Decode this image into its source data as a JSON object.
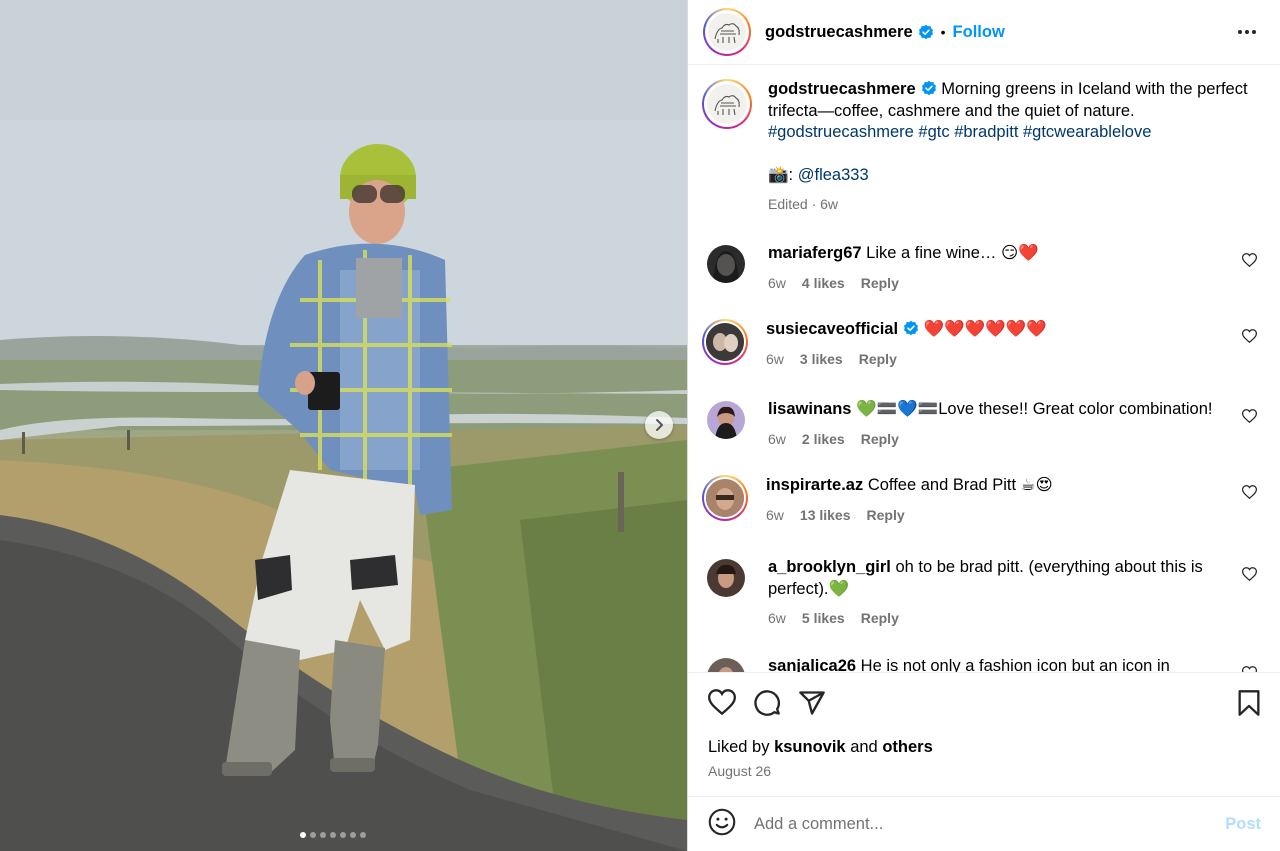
{
  "post": {
    "author": "godstruecashmere",
    "follow_label": "Follow",
    "separator": "•",
    "caption": {
      "username": "godstruecashmere",
      "text": " Morning greens in Iceland with the perfect trifecta—coffee, cashmere and the quiet of nature.",
      "hashtags": "#godstruecashmere #gtc #bradpitt #gtcwearablelove",
      "credit_emoji": "📸:",
      "credit_mention": "@flea333",
      "edited": "Edited · 6w"
    },
    "liked_by_prefix": "Liked by",
    "liked_by_user": "ksunovik",
    "liked_by_and": "and",
    "liked_by_others": "others",
    "date": "August 26"
  },
  "media": {
    "carousel_count": 7,
    "carousel_active": 1
  },
  "comments": [
    {
      "username": "mariaferg67",
      "text": "Like a fine wine… 😏❤️",
      "time": "6w",
      "likes": "4 likes",
      "reply": "Reply"
    },
    {
      "username": "susiecaveofficial",
      "text": "❤️❤️❤️❤️❤️❤️",
      "time": "6w",
      "likes": "3 likes",
      "reply": "Reply"
    },
    {
      "username": "lisawinans",
      "text": "💚🟰💙🟰Love these!! Great color combination!",
      "time": "6w",
      "likes": "2 likes",
      "reply": "Reply"
    },
    {
      "username": "inspirarte.az",
      "text": "Coffee and Brad Pitt ☕😍",
      "time": "6w",
      "likes": "13 likes",
      "reply": "Reply"
    },
    {
      "username": "a_brooklyn_girl",
      "text": "oh to be brad pitt. (everything about this is perfect).💚",
      "time": "6w",
      "likes": "5 likes",
      "reply": "Reply"
    },
    {
      "username": "sanjalica26",
      "text": "He is not only a fashion icon but an icon in",
      "time": "",
      "likes": "",
      "reply": ""
    }
  ],
  "composer": {
    "placeholder": "Add a comment...",
    "post_label": "Post"
  },
  "colors": {
    "accent": "#0095f6",
    "link": "#00376b",
    "muted": "#737373",
    "post_disabled": "#b2dffc"
  },
  "icons": [
    "more-icon",
    "verified-icon",
    "heart-icon",
    "comment-icon",
    "share-icon",
    "bookmark-icon",
    "emoji-icon",
    "chevron-right-icon"
  ]
}
